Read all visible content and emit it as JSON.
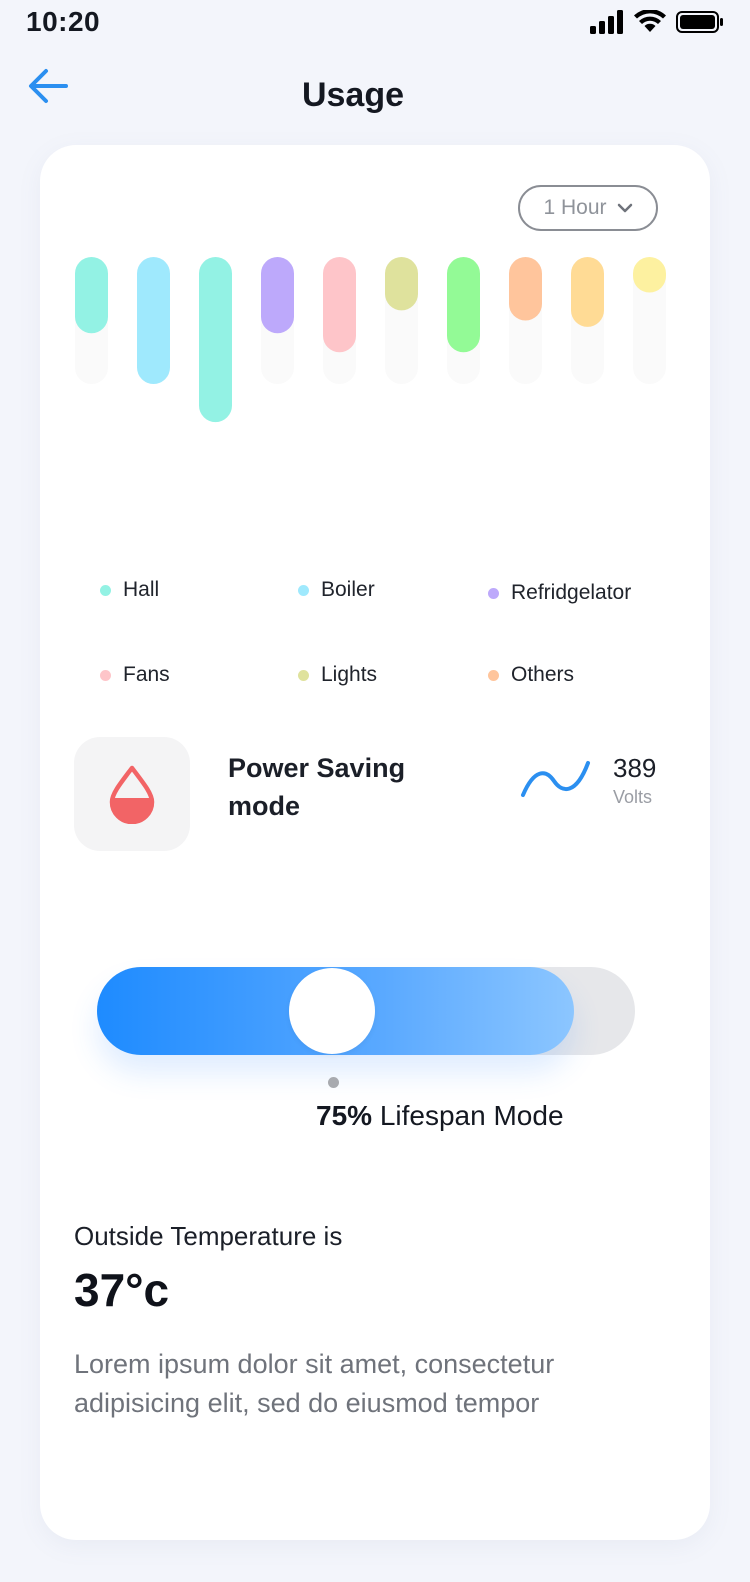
{
  "status_bar": {
    "time": "10:20"
  },
  "header": {
    "title": "Usage"
  },
  "range": {
    "label": "1 Hour"
  },
  "chart_data": {
    "type": "bar",
    "values": [
      0.6,
      1.0,
      1.3,
      0.6,
      0.75,
      0.42,
      0.75,
      0.5,
      0.55,
      0.28
    ],
    "track": 1.0,
    "colors": [
      "#93f2e4",
      "#9fe9fd",
      "#93f2e4",
      "#bda9fb",
      "#fec5c9",
      "#dfe29d",
      "#93fa96",
      "#ffc59c",
      "#ffdb95",
      "#fdf1a0"
    ]
  },
  "legend": [
    {
      "label": "Hall",
      "color": "#93f2e4"
    },
    {
      "label": "Boiler",
      "color": "#9fe9fd"
    },
    {
      "label": "Refridgelator",
      "color": "#bda9fb"
    },
    {
      "label": "Fans",
      "color": "#fec5c9"
    },
    {
      "label": "Lights",
      "color": "#dfe29d"
    },
    {
      "label": "Others",
      "color": "#ffc59c"
    }
  ],
  "power_mode": {
    "title": "Power Saving mode",
    "volts_value": "389",
    "volts_unit": "Volts",
    "icon": "droplet-icon",
    "accent": "#f26466"
  },
  "slider": {
    "fraction": 0.75,
    "percent": "75%",
    "label": "Lifespan Mode",
    "accent": "#1e8bff"
  },
  "temperature": {
    "label": "Outside Temperature is",
    "value": "37°c",
    "description": "Lorem ipsum dolor sit amet, consectetur adipisicing elit, sed do eiusmod tempor"
  }
}
